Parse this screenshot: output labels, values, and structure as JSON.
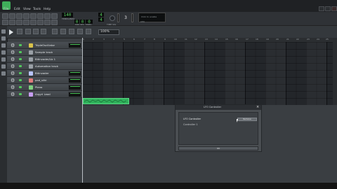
{
  "menu": {
    "items": [
      "File",
      "Edit",
      "View",
      "Tools",
      "Help"
    ]
  },
  "toolbar": {
    "tempo": "140",
    "tempo_label": "TEMPO/BPM",
    "time_min": "0",
    "time_sec": "0",
    "time_msec": "0",
    "time_labels": [
      "MIN",
      "SEC",
      "MSEC"
    ],
    "sig_num": "4",
    "sig_den": "4",
    "sig_label": "TIME SIG",
    "master_pitch": "3",
    "cpu_text": "Click to enable",
    "cpu_label": "CPU"
  },
  "song_editor": {
    "zoom": "100%",
    "ruler": [
      "1",
      "2",
      "3",
      "4",
      "5",
      "6",
      "7",
      "8",
      "9",
      "10",
      "11",
      "12",
      "13",
      "14",
      "15",
      "16",
      "17",
      "18",
      "19",
      "20",
      "21",
      "22",
      "23",
      "24",
      "25"
    ],
    "tracks": [
      {
        "name": "TripleOscillator",
        "color": "#d9c24a"
      },
      {
        "name": "Sample track",
        "color": "#9aa0a6"
      },
      {
        "name": "BitInvader/Lb 1",
        "color": "#9aa0a6"
      },
      {
        "name": "Automation track",
        "color": "#9aa0a6"
      },
      {
        "name": "Bitinvader",
        "color": "#b8c4ff"
      },
      {
        "name": "pad_silki",
        "color": "#e07b7b"
      },
      {
        "name": "Piano",
        "color": "#7fd07f"
      },
      {
        "name": "Argyrl Lead",
        "color": "#c79df2"
      }
    ]
  },
  "dialog": {
    "title": "LFO Controller",
    "controller_type": "LFO Controller",
    "controller_name": "Controller 1",
    "button_label": "Remove",
    "bottom_label": "OK"
  }
}
